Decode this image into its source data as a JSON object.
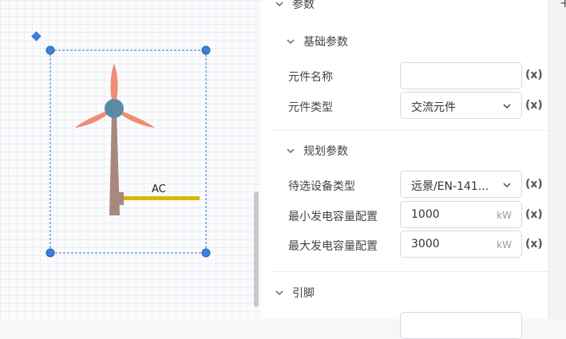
{
  "panel": {
    "top_section": "参数",
    "basic_section": "基础参数",
    "planning_section": "规划参数",
    "pins_section": "引脚",
    "x_marker": "(x)",
    "fields": {
      "name": {
        "label": "元件名称",
        "value": ""
      },
      "type": {
        "label": "元件类型",
        "value": "交流元件"
      },
      "device": {
        "label": "待选设备类型",
        "value": "远景/EN-141..."
      },
      "min_cap": {
        "label": "最小发电容量配置",
        "value": "1000",
        "unit": "kW"
      },
      "max_cap": {
        "label": "最大发电容量配置",
        "value": "3000",
        "unit": "kW"
      }
    }
  },
  "canvas": {
    "component": {
      "name": "wind-turbine",
      "port_label": "AC"
    }
  },
  "colors": {
    "blade": "#f08d72",
    "hub": "#5b8aa6",
    "tower": "#a8877f",
    "port": "#d9b800",
    "handle": "#3d7fd9"
  }
}
